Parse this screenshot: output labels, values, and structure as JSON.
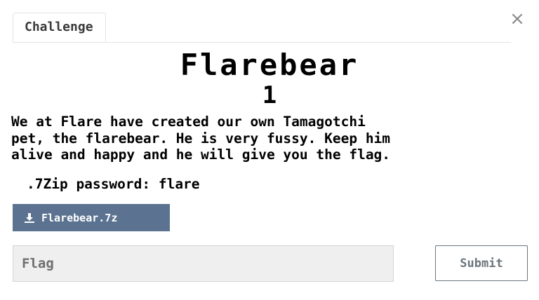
{
  "tabs": [
    {
      "label": "Challenge"
    }
  ],
  "close_icon": "close-icon",
  "challenge": {
    "name": "Flarebear",
    "points": "1",
    "description": "We at Flare have created our own Tamagotchi\npet, the flarebear. He is very fussy. Keep him\nalive and happy and he will give you the flag.",
    "zip_password": ".7Zip password: flare"
  },
  "download": {
    "icon": "download-icon",
    "label": "Flarebear.7z"
  },
  "flag_input": {
    "value": "",
    "placeholder": "Flag"
  },
  "submit": {
    "label": "Submit"
  },
  "colors": {
    "download_button_bg": "#5b7290",
    "submit_border": "#6c757d",
    "input_bg": "#efefef"
  }
}
